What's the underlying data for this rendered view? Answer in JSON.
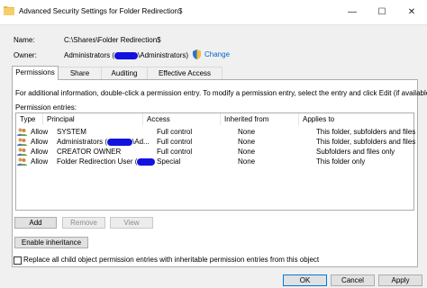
{
  "window": {
    "title": "Advanced Security Settings for Folder Redirection$",
    "minimize": "—",
    "maximize": "☐",
    "close": "✕"
  },
  "fields": {
    "name_label": "Name:",
    "name_value": "C:\\Shares\\Folder Redirection$",
    "owner_label": "Owner:",
    "owner_prefix": "Administrators (",
    "owner_suffix": "\\Administrators)",
    "change_link": "Change"
  },
  "tabs": [
    "Permissions",
    "Share",
    "Auditing",
    "Effective Access"
  ],
  "permissions": {
    "info_text": "For additional information, double-click a permission entry. To modify a permission entry, select the entry and click Edit (if available).",
    "entries_label": "Permission entries:",
    "columns": [
      "Type",
      "Principal",
      "Access",
      "Inherited from",
      "Applies to"
    ],
    "rows": [
      {
        "type": "Allow",
        "principal": "SYSTEM",
        "access": "Full control",
        "inherited": "None",
        "applies": "This folder, subfolders and files"
      },
      {
        "type": "Allow",
        "principal": "Administrators (",
        "principal_tail": "\\Ad...",
        "access": "Full control",
        "inherited": "None",
        "applies": "This folder, subfolders and files"
      },
      {
        "type": "Allow",
        "principal": "CREATOR OWNER",
        "access": "Full control",
        "inherited": "None",
        "applies": "Subfolders and files only"
      },
      {
        "type": "Allow",
        "principal": "Folder Redirection User (",
        "access": "Special",
        "inherited": "None",
        "applies": "This folder only"
      }
    ]
  },
  "buttons": {
    "add": "Add",
    "remove": "Remove",
    "view": "View",
    "enable_inheritance": "Enable inheritance",
    "ok": "OK",
    "cancel": "Cancel",
    "apply": "Apply"
  },
  "replace_checkbox": {
    "label": "Replace all child object permission entries with inheritable permission entries from this object",
    "checked": false
  },
  "colors": {
    "accent": "#0078d7",
    "link": "#0066cc",
    "redaction": "#1313e0"
  }
}
